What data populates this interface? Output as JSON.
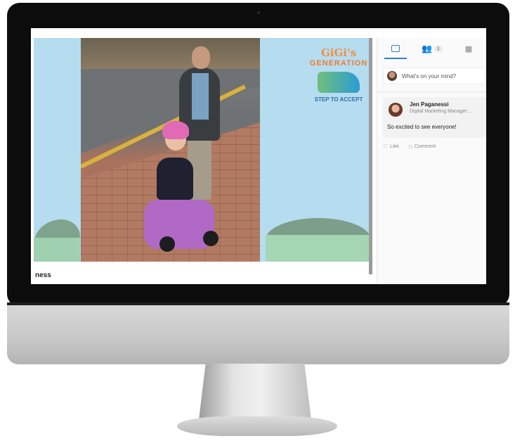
{
  "video": {
    "logo": {
      "title_line1": "GiGi's",
      "title_line2": "GENERATION",
      "tagline": "STEP TO ACCEPT"
    },
    "below_label": "ness"
  },
  "sidebar": {
    "tabs": [
      {
        "name": "chat-tab",
        "icon": "chat-icon",
        "active": true
      },
      {
        "name": "people-tab",
        "icon": "people-icon",
        "count": "1"
      },
      {
        "name": "polls-tab",
        "icon": "bar-chart-icon"
      }
    ],
    "composer": {
      "placeholder": "What's on your mind?"
    },
    "post": {
      "author": "Jen Paganessi",
      "role": "Digital Marketing Manager...",
      "text": "So excited to see everyone!",
      "like_label": "Like",
      "comment_label": "Comment"
    }
  },
  "colors": {
    "accent": "#2e7ce4",
    "video_bg": "#b6dcf0",
    "logo_orange": "#f2903b"
  }
}
